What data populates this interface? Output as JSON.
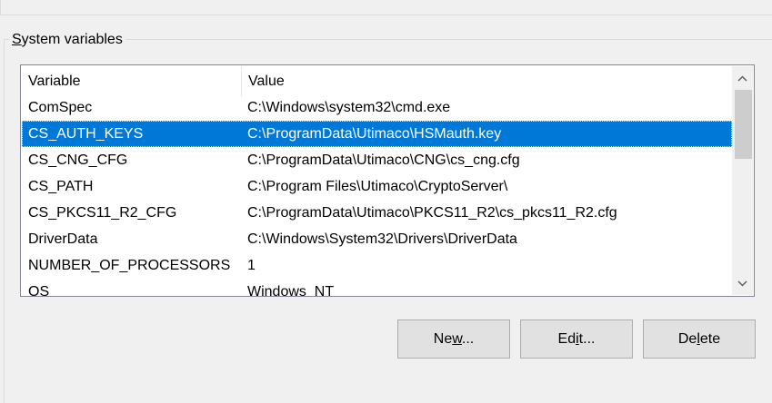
{
  "group": {
    "label": "System variables",
    "label_access_key": "S"
  },
  "table": {
    "columns": [
      "Variable",
      "Value"
    ],
    "rows": [
      {
        "variable": "ComSpec",
        "value": "C:\\Windows\\system32\\cmd.exe",
        "selected": false
      },
      {
        "variable": "CS_AUTH_KEYS",
        "value": "C:\\ProgramData\\Utimaco\\HSMauth.key",
        "selected": true
      },
      {
        "variable": "CS_CNG_CFG",
        "value": "C:\\ProgramData\\Utimaco\\CNG\\cs_cng.cfg",
        "selected": false
      },
      {
        "variable": "CS_PATH",
        "value": "C:\\Program Files\\Utimaco\\CryptoServer\\",
        "selected": false
      },
      {
        "variable": "CS_PKCS11_R2_CFG",
        "value": "C:\\ProgramData\\Utimaco\\PKCS11_R2\\cs_pkcs11_R2.cfg",
        "selected": false
      },
      {
        "variable": "DriverData",
        "value": "C:\\Windows\\System32\\Drivers\\DriverData",
        "selected": false
      },
      {
        "variable": "NUMBER_OF_PROCESSORS",
        "value": "1",
        "selected": false
      },
      {
        "variable": "OS",
        "value": "Windows_NT",
        "selected": false
      }
    ]
  },
  "buttons": {
    "new": {
      "label": "New...",
      "access_key": "w"
    },
    "edit": {
      "label": "Edit...",
      "access_key": "i"
    },
    "delete": {
      "label": "Delete",
      "access_key": "l"
    }
  },
  "icons": {
    "scroll_up": "chevron-up-icon",
    "scroll_down": "chevron-down-icon"
  },
  "colors": {
    "selection": "#0078d7",
    "window_bg": "#f0f0f0",
    "list_bg": "#ffffff",
    "button_bg": "#e1e1e1"
  }
}
